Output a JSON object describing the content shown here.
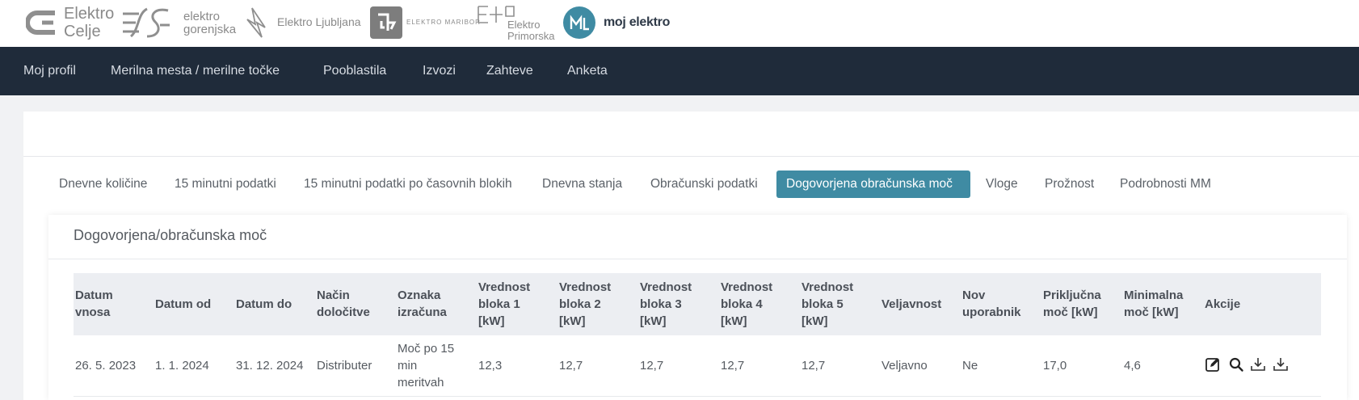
{
  "logos": {
    "celje_line1": "Elektro",
    "celje_line2": "Celje",
    "gorenjska_line1": "elektro",
    "gorenjska_line2": "gorenjska",
    "ljubljana": "Elektro Ljubljana",
    "maribor": "ELEKTRO MARIBOR",
    "primorska_line1": "Elektro",
    "primorska_line2": "Primorska",
    "moj_elektro": "moj elektro"
  },
  "mainnav": {
    "items": [
      "Moj profil",
      "Merilna mesta / merilne točke",
      "Pooblastila",
      "Izvozi",
      "Zahteve",
      "Anketa"
    ]
  },
  "tabs": {
    "items": [
      "Dnevne količine",
      "15 minutni podatki",
      "15 minutni podatki po časovnih blokih",
      "Dnevna stanja",
      "Obračunski podatki",
      "Dogovorjena obračunska moč",
      "Vloge",
      "Prožnost",
      "Podrobnosti MM"
    ],
    "active": "Dogovorjena obračunska moč"
  },
  "card": {
    "title": "Dogovorjena/obračunska moč"
  },
  "table": {
    "headers": [
      [
        "Datum",
        "vnosa"
      ],
      [
        "Datum od"
      ],
      [
        "Datum do"
      ],
      [
        "Način",
        "določitve"
      ],
      [
        "Oznaka",
        "izračuna"
      ],
      [
        "Vrednost",
        "bloka 1",
        "[kW]"
      ],
      [
        "Vrednost",
        "bloka 2",
        "[kW]"
      ],
      [
        "Vrednost",
        "bloka 3",
        "[kW]"
      ],
      [
        "Vrednost",
        "bloka 4",
        "[kW]"
      ],
      [
        "Vrednost",
        "bloka 5",
        "[kW]"
      ],
      [
        "Veljavnost"
      ],
      [
        "Nov",
        "uporabnik"
      ],
      [
        "Priključna",
        "moč [kW]"
      ],
      [
        "Minimalna",
        "moč [kW]"
      ],
      [
        "Akcije"
      ]
    ],
    "rows": [
      [
        "26. 5. 2023",
        "1. 1. 2024",
        "31. 12. 2024",
        "Distributer",
        [
          "Moč po 15",
          "min",
          "meritvah"
        ],
        "12,3",
        "12,7",
        "12,7",
        "12,7",
        "12,7",
        "Veljavno",
        "Ne",
        "17,0",
        "4,6"
      ]
    ],
    "actions": [
      "edit-icon",
      "search-icon",
      "download-icon",
      "download-icon"
    ]
  },
  "colors": {
    "nav_bg": "#1f2b3a",
    "tab_active": "#3f8ba3",
    "header_bg": "#eceef2",
    "moj_elektro": "#3f8ba3"
  }
}
